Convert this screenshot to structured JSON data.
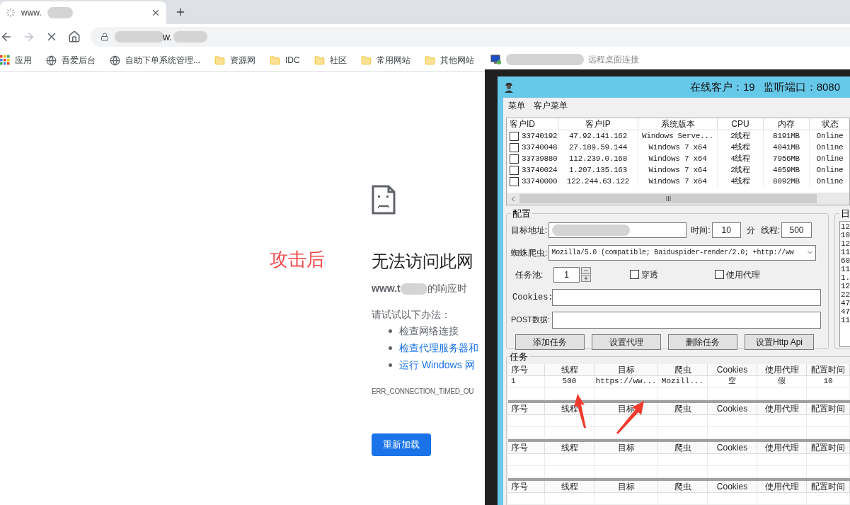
{
  "browser": {
    "tab": {
      "title": "www."
    },
    "address": {
      "url_fragment": "w."
    },
    "bookmarks": [
      {
        "label": "应用",
        "kind": "apps"
      },
      {
        "label": "吾爱后台",
        "kind": "site"
      },
      {
        "label": "自助下单系统管理...",
        "kind": "site"
      },
      {
        "label": "资源网",
        "kind": "folder"
      },
      {
        "label": "IDC",
        "kind": "folder"
      },
      {
        "label": "社区",
        "kind": "folder"
      },
      {
        "label": "常用网站",
        "kind": "folder"
      },
      {
        "label": "其他网站",
        "kind": "folder"
      }
    ]
  },
  "error_page": {
    "annotation": "攻击后",
    "title": "无法访问此网",
    "host": "www.t",
    "message": "的响应时",
    "suggestions_heading": "请试试以下办法：",
    "suggestions": [
      {
        "text": "检查网络连接",
        "link": false
      },
      {
        "text": "检查代理服务器和",
        "link": true
      },
      {
        "text": "运行 Windows 网",
        "link": true
      }
    ],
    "error_code": "ERR_CONNECTION_TIMED_OU",
    "reload_button": "重新加载"
  },
  "remote_desktop": {
    "title": "远程桌面连接",
    "app": {
      "online_clients": "在线客户：19",
      "listen_port": "监听端口：8080",
      "menu": [
        "菜单",
        "客户菜单"
      ],
      "clients": {
        "columns": [
          "客户ID",
          "客户IP",
          "系统版本",
          "CPU",
          "内存",
          "状态"
        ],
        "rows": [
          {
            "checked": false,
            "cells": [
              "33740192",
              "47.92.141.162",
              "Windows Serve...",
              "2线程",
              "8191MB",
              "Online"
            ]
          },
          {
            "checked": false,
            "cells": [
              "33740048",
              "27.189.59.144",
              "Windows 7 x64",
              "4线程",
              "4041MB",
              "Online"
            ]
          },
          {
            "checked": false,
            "cells": [
              "33739880",
              "112.239.0.168",
              "Windows 7 x64",
              "4线程",
              "7956MB",
              "Online"
            ]
          },
          {
            "checked": false,
            "cells": [
              "33740024",
              "1.207.135.163",
              "Windows 7 x64",
              "2线程",
              "4059MB",
              "Online"
            ]
          },
          {
            "checked": false,
            "cells": [
              "33740000",
              "122.244.63.122",
              "Windows 7 x64",
              "4线程",
              "8092MB",
              "Online"
            ]
          }
        ]
      },
      "config": {
        "title": "配置",
        "target_label": "目标地址:",
        "time_label": "时间:",
        "time_value": "10",
        "time_unit": "分",
        "threads_label": "线程:",
        "threads_value": "500",
        "spider_label": "蜘蛛爬虫:",
        "spider_value": "Mozilla/5.0 (compatible; Baiduspider-render/2.0; +http://ww",
        "pool_label": "任务池:",
        "pool_value": "1",
        "options": [
          {
            "label": "穿透",
            "checked": false
          },
          {
            "label": "使用代理",
            "checked": false
          }
        ],
        "cookies_label": "Cookies:",
        "post_label": "POST数据:",
        "buttons": [
          "添加任务",
          "设置代理",
          "删除任务",
          "设置Http Api"
        ]
      },
      "log": {
        "title": "日",
        "lines": [
          "12",
          "10",
          "12",
          "11",
          "60",
          "11",
          "1.",
          "12",
          "22",
          "47",
          "47",
          "11"
        ]
      },
      "tasks": {
        "title": "任务",
        "tables": [
          {
            "columns": [
              "序号",
              "线程",
              "目标",
              "爬虫",
              "Cookies",
              "使用代理",
              "配置时间"
            ],
            "rows": [
              [
                "1",
                "500",
                "https://ww...",
                "Mozill...",
                "空",
                "假",
                "10"
              ]
            ]
          },
          {
            "columns": [
              "序号",
              "线程",
              "目标",
              "爬虫",
              "Cookies",
              "使用代理",
              "配置时间"
            ]
          },
          {
            "columns": [
              "序号",
              "线程",
              "目标",
              "爬虫",
              "Cookies",
              "使用代理",
              "配置时间"
            ]
          },
          {
            "columns": [
              "序号",
              "线程",
              "目标",
              "爬虫",
              "Cookies",
              "使用代理",
              "配置时间"
            ]
          }
        ]
      }
    }
  }
}
